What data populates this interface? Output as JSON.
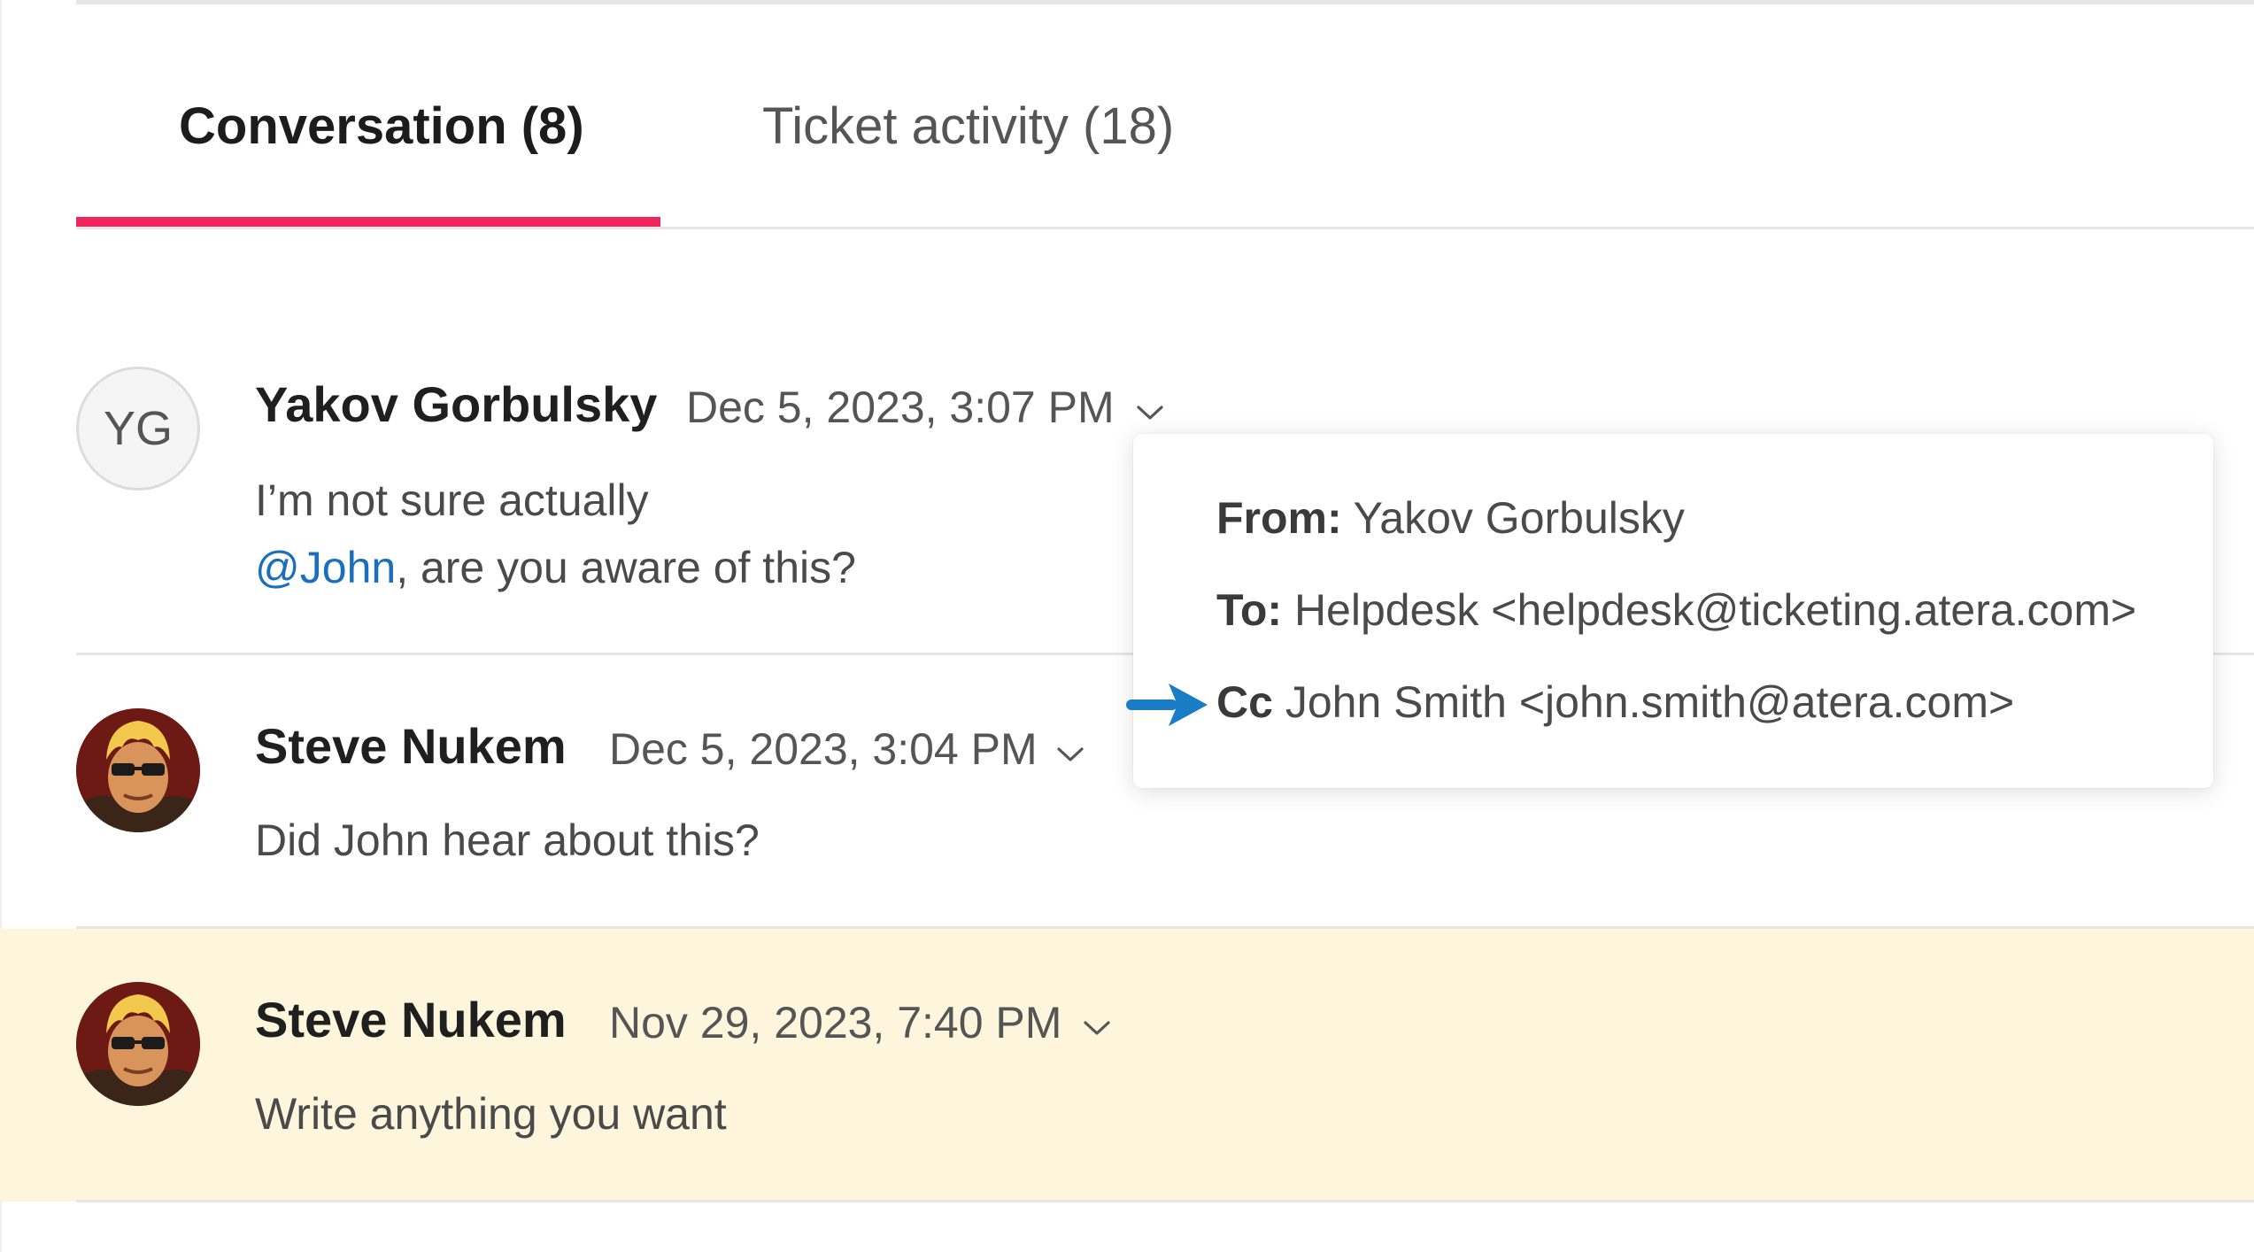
{
  "tabs": [
    {
      "label": "Conversation (8)",
      "active": true
    },
    {
      "label": "Ticket activity (18)",
      "active": false
    }
  ],
  "accent_color": "#f0245f",
  "highlight_color": "#fdf6dc",
  "messages": [
    {
      "avatar_initials": "YG",
      "sender": "Yakov Gorbulsky",
      "timestamp": "Dec 5, 2023, 3:07 PM",
      "line1": "I’m not sure actually",
      "mention": "@John",
      "line2_rest": ", are you aware of this?"
    },
    {
      "avatar": "photo-avatar",
      "sender": "Steve Nukem",
      "timestamp": "Dec 5, 2023, 3:04 PM",
      "line1": "Did John hear about this?"
    },
    {
      "avatar": "photo-avatar",
      "sender": "Steve Nukem",
      "timestamp": "Nov 29, 2023, 7:40 PM",
      "line1": "Write anything you want",
      "highlighted": true
    }
  ],
  "details_popover": {
    "from_label": "From:",
    "from_value": "Yakov Gorbulsky",
    "to_label": "To:",
    "to_value": "Helpdesk <helpdesk@ticketing.atera.com>",
    "cc_label": "Cc",
    "cc_value": "John Smith <john.smith@atera.com>"
  },
  "icons": {
    "dropdown": "chevron-down-icon",
    "pointer": "arrow-right-icon"
  }
}
